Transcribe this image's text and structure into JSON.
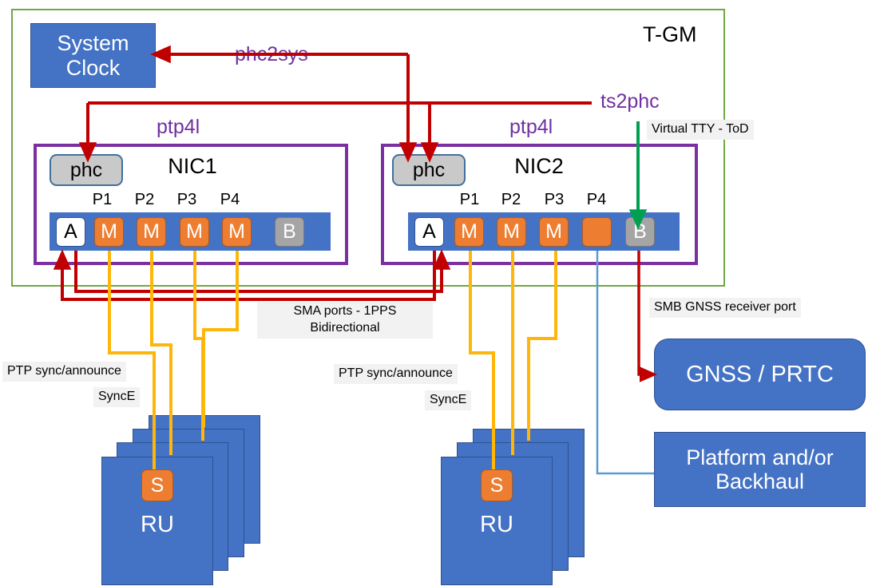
{
  "diagram": {
    "title": "T-GM",
    "tgm_label": "T-GM"
  },
  "colors": {
    "tgm_border": "#70A845",
    "nic_border": "#7030A0",
    "blue_fill": "#4472C4",
    "blue_stroke": "#2F528F",
    "orange": "#ED7D31",
    "red": "#C00000",
    "green_line": "#00A050",
    "lightblue_line": "#5B9BD5",
    "gray_chip": "#A5A5A5",
    "phc_gray": "#C9C9C9",
    "purple_text": "#7030A0"
  },
  "system_clock": {
    "line1": "System",
    "line2": "Clock"
  },
  "processes": {
    "phc2sys": "phc2sys",
    "ts2phc": "ts2phc",
    "ptp4l_nic1": "ptp4l",
    "ptp4l_nic2": "ptp4l"
  },
  "nic1": {
    "title": "NIC1",
    "phc": "phc",
    "port_labels": [
      "P1",
      "P2",
      "P3",
      "P4"
    ],
    "ports": [
      {
        "label": "A",
        "kind": "a"
      },
      {
        "label": "M",
        "kind": "m"
      },
      {
        "label": "M",
        "kind": "m"
      },
      {
        "label": "M",
        "kind": "m"
      },
      {
        "label": "M",
        "kind": "m"
      },
      {
        "label": "B",
        "kind": "b"
      }
    ]
  },
  "nic2": {
    "title": "NIC2",
    "phc": "phc",
    "port_labels": [
      "P1",
      "P2",
      "P3",
      "P4"
    ],
    "ports": [
      {
        "label": "A",
        "kind": "a"
      },
      {
        "label": "M",
        "kind": "m"
      },
      {
        "label": "M",
        "kind": "m"
      },
      {
        "label": "M",
        "kind": "m"
      },
      {
        "label": "",
        "kind": "m"
      },
      {
        "label": "B",
        "kind": "b"
      }
    ]
  },
  "annotations": {
    "virtual_tty": "Virtual TTY - ToD",
    "sma_line1": "SMA ports - 1PPS",
    "sma_line2": "Bidirectional",
    "smb_gnss": "SMB GNSS receiver port",
    "ptp_sync_left": "PTP sync/announce",
    "synce_left": "SyncE",
    "ptp_sync_right": "PTP sync/announce",
    "synce_right": "SyncE"
  },
  "gnss": {
    "label": "GNSS / PRTC"
  },
  "platform": {
    "line1": "Platform and/or",
    "line2": "Backhaul"
  },
  "ru_left": {
    "label": "RU",
    "chip": "S",
    "stack_count": 4
  },
  "ru_right": {
    "label": "RU",
    "chip": "S",
    "stack_count": 3
  }
}
